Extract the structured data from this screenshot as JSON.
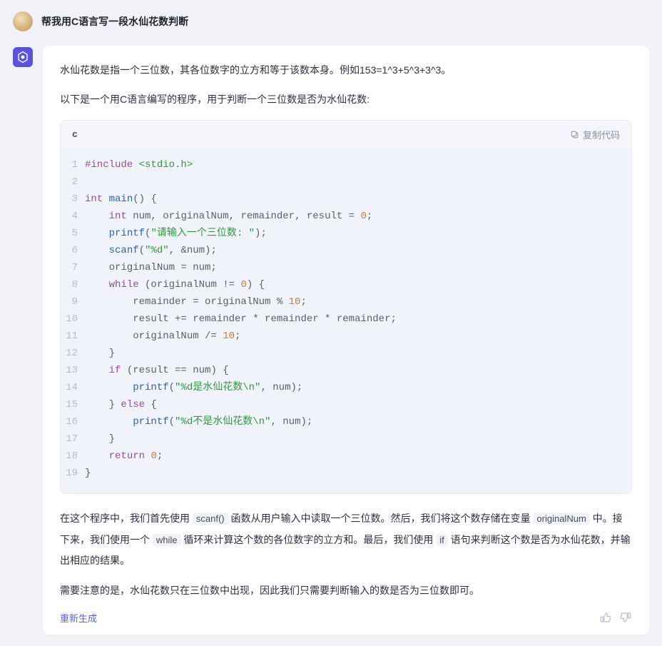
{
  "user": {
    "prompt": "帮我用C语言写一段水仙花数判断"
  },
  "assistant": {
    "intro1": "水仙花数是指一个三位数，其各位数字的立方和等于该数本身。例如153=1^3+5^3+3^3。",
    "intro2": "以下是一个用C语言编写的程序，用于判断一个三位数是否为水仙花数:",
    "code": {
      "language": "c",
      "copy_label": "复制代码",
      "lines": [
        [
          {
            "t": "#include",
            "c": "pp"
          },
          {
            "t": " ",
            "c": "op"
          },
          {
            "t": "<stdio.h>",
            "c": "hdr"
          }
        ],
        [],
        [
          {
            "t": "int",
            "c": "kw"
          },
          {
            "t": " ",
            "c": "op"
          },
          {
            "t": "main",
            "c": "fn"
          },
          {
            "t": "() {",
            "c": "op"
          }
        ],
        [
          {
            "t": "    ",
            "c": "op"
          },
          {
            "t": "int",
            "c": "kw"
          },
          {
            "t": " num, originalNum, remainder, result = ",
            "c": "op"
          },
          {
            "t": "0",
            "c": "num"
          },
          {
            "t": ";",
            "c": "op"
          }
        ],
        [
          {
            "t": "    ",
            "c": "op"
          },
          {
            "t": "printf",
            "c": "fn"
          },
          {
            "t": "(",
            "c": "op"
          },
          {
            "t": "\"请输入一个三位数: \"",
            "c": "str"
          },
          {
            "t": ");",
            "c": "op"
          }
        ],
        [
          {
            "t": "    ",
            "c": "op"
          },
          {
            "t": "scanf",
            "c": "fn"
          },
          {
            "t": "(",
            "c": "op"
          },
          {
            "t": "\"%d\"",
            "c": "str"
          },
          {
            "t": ", &num);",
            "c": "op"
          }
        ],
        [
          {
            "t": "    originalNum = num;",
            "c": "op"
          }
        ],
        [
          {
            "t": "    ",
            "c": "op"
          },
          {
            "t": "while",
            "c": "kw"
          },
          {
            "t": " (originalNum != ",
            "c": "op"
          },
          {
            "t": "0",
            "c": "num"
          },
          {
            "t": ") {",
            "c": "op"
          }
        ],
        [
          {
            "t": "        remainder = originalNum % ",
            "c": "op"
          },
          {
            "t": "10",
            "c": "num"
          },
          {
            "t": ";",
            "c": "op"
          }
        ],
        [
          {
            "t": "        result += remainder * remainder * remainder;",
            "c": "op"
          }
        ],
        [
          {
            "t": "        originalNum /= ",
            "c": "op"
          },
          {
            "t": "10",
            "c": "num"
          },
          {
            "t": ";",
            "c": "op"
          }
        ],
        [
          {
            "t": "    }",
            "c": "op"
          }
        ],
        [
          {
            "t": "    ",
            "c": "op"
          },
          {
            "t": "if",
            "c": "kw"
          },
          {
            "t": " (result == num) {",
            "c": "op"
          }
        ],
        [
          {
            "t": "        ",
            "c": "op"
          },
          {
            "t": "printf",
            "c": "fn"
          },
          {
            "t": "(",
            "c": "op"
          },
          {
            "t": "\"%d是水仙花数\\n\"",
            "c": "str"
          },
          {
            "t": ", num);",
            "c": "op"
          }
        ],
        [
          {
            "t": "    } ",
            "c": "op"
          },
          {
            "t": "else",
            "c": "kw"
          },
          {
            "t": " {",
            "c": "op"
          }
        ],
        [
          {
            "t": "        ",
            "c": "op"
          },
          {
            "t": "printf",
            "c": "fn"
          },
          {
            "t": "(",
            "c": "op"
          },
          {
            "t": "\"%d不是水仙花数\\n\"",
            "c": "str"
          },
          {
            "t": ", num);",
            "c": "op"
          }
        ],
        [
          {
            "t": "    }",
            "c": "op"
          }
        ],
        [
          {
            "t": "    ",
            "c": "op"
          },
          {
            "t": "return",
            "c": "kw"
          },
          {
            "t": " ",
            "c": "op"
          },
          {
            "t": "0",
            "c": "num"
          },
          {
            "t": ";",
            "c": "op"
          }
        ],
        [
          {
            "t": "}",
            "c": "op"
          }
        ]
      ]
    },
    "explain": {
      "p1a": "在这个程序中，我们首先使用 ",
      "ic1": "scanf()",
      "p1b": " 函数从用户输入中读取一个三位数。然后，我们将这个数存储在变量 ",
      "ic2": "originalNum",
      "p1c": " 中。接下来，我们使用一个 ",
      "ic3": "while",
      "p1d": " 循环来计算这个数的各位数字的立方和。最后，我们使用 ",
      "ic4": "if",
      "p1e": " 语句来判断这个数是否为水仙花数，并输出相应的结果。",
      "p2": "需要注意的是，水仙花数只在三位数中出现，因此我们只需要判断输入的数是否为三位数即可。"
    },
    "regenerate_label": "重新生成"
  }
}
